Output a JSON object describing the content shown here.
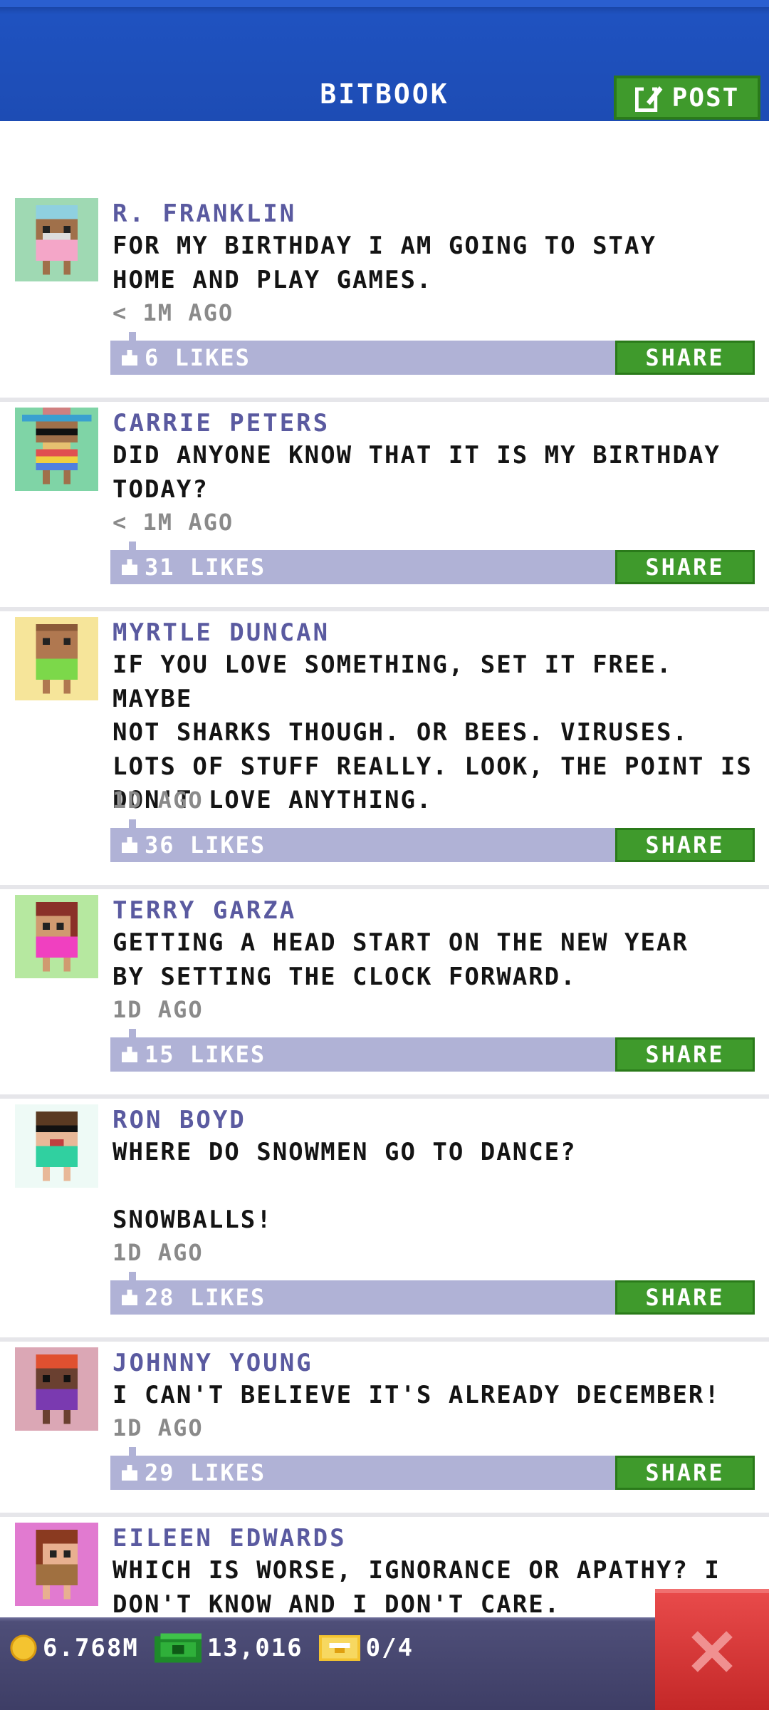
{
  "header": {
    "title": "BITBOOK",
    "post_label": "POST",
    "colors": {
      "bar": "#1d4cb4",
      "post_button": "#3f9a2c"
    }
  },
  "posts": [
    {
      "name": "R. FRANKLIN",
      "text": "FOR MY BIRTHDAY I AM GOING TO STAY\nHOME AND PLAY GAMES.",
      "time": "< 1M AGO",
      "likes": "6 LIKES",
      "share": "SHARE",
      "avatar_bg": "#9fd9b3"
    },
    {
      "name": "CARRIE PETERS",
      "text": "DID ANYONE KNOW THAT IT IS MY BIRTHDAY\nTODAY?",
      "time": "< 1M AGO",
      "likes": "31 LIKES",
      "share": "SHARE",
      "avatar_bg": "#7fd4a6"
    },
    {
      "name": "MYRTLE DUNCAN",
      "text": "IF YOU LOVE SOMETHING, SET IT FREE. MAYBE\nNOT SHARKS THOUGH. OR BEES. VIRUSES.\nLOTS OF STUFF REALLY. LOOK, THE POINT IS\nDON'T LOVE ANYTHING.",
      "time": "1D AGO",
      "likes": "36 LIKES",
      "share": "SHARE",
      "avatar_bg": "#f6e59a"
    },
    {
      "name": "TERRY GARZA",
      "text": "GETTING A HEAD START ON THE NEW YEAR\nBY SETTING THE CLOCK FORWARD.",
      "time": "1D AGO",
      "likes": "15 LIKES",
      "share": "SHARE",
      "avatar_bg": "#b6e8a0"
    },
    {
      "name": "RON BOYD",
      "text": "WHERE DO SNOWMEN GO TO DANCE?\n\nSNOWBALLS!",
      "time": "1D AGO",
      "likes": "28 LIKES",
      "share": "SHARE",
      "avatar_bg": "#eefaf6"
    },
    {
      "name": "JOHNNY YOUNG",
      "text": "I CAN'T BELIEVE IT'S ALREADY DECEMBER!",
      "time": "1D AGO",
      "likes": "29 LIKES",
      "share": "SHARE",
      "avatar_bg": "#dba7b5"
    },
    {
      "name": "EILEEN EDWARDS",
      "text": "WHICH IS WORSE, IGNORANCE OR APATHY? I\nDON'T KNOW AND I DON'T CARE.",
      "time": "",
      "likes": "",
      "share": "",
      "avatar_bg": "#e17ad0"
    }
  ],
  "footer": {
    "coins": "6.768M",
    "bux": "13,016",
    "tickets": "0/4",
    "close_icon": "close-x-icon"
  }
}
